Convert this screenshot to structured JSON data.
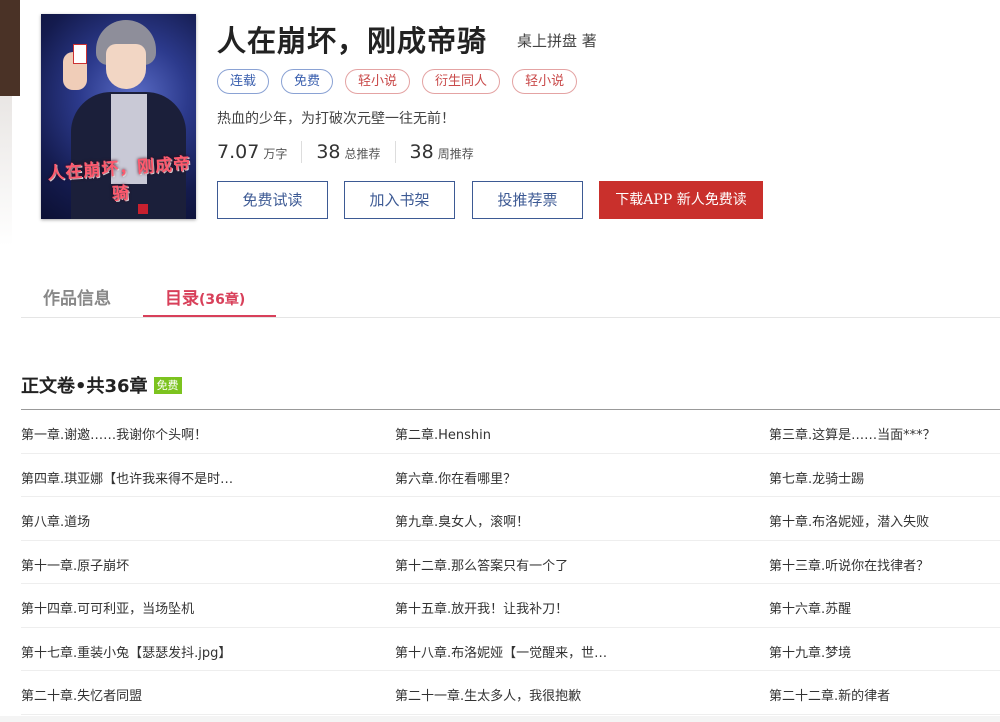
{
  "book": {
    "title": "人在崩坏，刚成帝骑",
    "author": "桌上拼盘 著",
    "intro": "热血的少年，为打破次元壁一往无前！",
    "cover_title": "人在崩坏，刚成帝骑",
    "tags": [
      {
        "label": "连载",
        "color": "blue"
      },
      {
        "label": "免费",
        "color": "blue"
      },
      {
        "label": "轻小说",
        "color": "red"
      },
      {
        "label": "衍生同人",
        "color": "red"
      },
      {
        "label": "轻小说",
        "color": "red"
      }
    ],
    "stats": {
      "words": {
        "num": "7.07",
        "unit": "万字"
      },
      "total_rec": {
        "num": "38",
        "unit": "总推荐"
      },
      "week_rec": {
        "num": "38",
        "unit": "周推荐"
      }
    }
  },
  "actions": {
    "free_read": "免费试读",
    "add_shelf": "加入书架",
    "vote": "投推荐票",
    "download_app": "下载APP  新人免费读"
  },
  "tabs": {
    "info": "作品信息",
    "toc": "目录",
    "toc_count": "(36章)"
  },
  "volume": {
    "title": "正文卷•共36章",
    "badge": "免费"
  },
  "chapters": [
    [
      "第一章.谢邀……我谢你个头啊！",
      "第二章.Henshin",
      "第三章.这算是……当面***？"
    ],
    [
      "第四章.琪亚娜【也许我来得不是时…",
      "第六章.你在看哪里？",
      "第七章.龙骑士踢"
    ],
    [
      "第八章.道场",
      "第九章.臭女人，滚啊！",
      "第十章.布洛妮娅，潜入失败"
    ],
    [
      "第十一章.原子崩坏",
      "第十二章.那么答案只有一个了",
      "第十三章.听说你在找律者？"
    ],
    [
      "第十四章.可可利亚，当场坠机",
      "第十五章.放开我！让我补刀！",
      "第十六章.苏醒"
    ],
    [
      "第十七章.重装小兔【瑟瑟发抖.jpg】",
      "第十八章.布洛妮娅【一觉醒来，世…",
      "第十九章.梦境"
    ],
    [
      "第二十章.失忆者同盟",
      "第二十一章.生太多人，我很抱歉",
      "第二十二章.新的律者"
    ]
  ],
  "colors": {
    "accent": "#d8405a",
    "button_blue": "#3d5a94",
    "app_red": "#c9302c",
    "free_green": "#7cc31f"
  }
}
